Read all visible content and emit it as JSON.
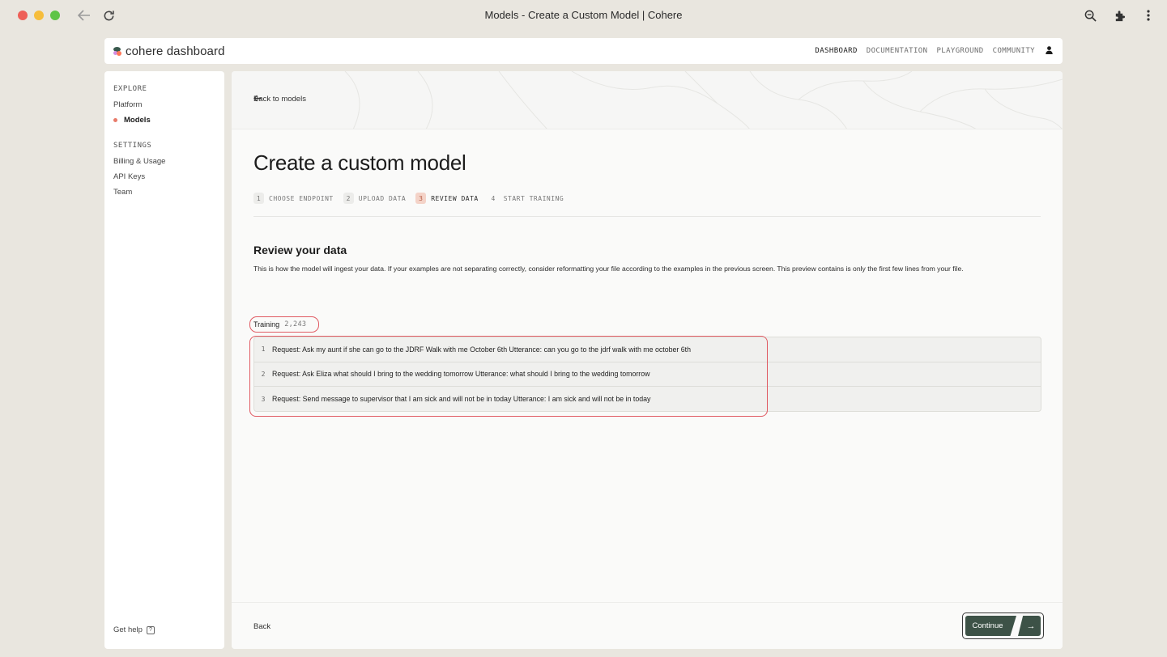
{
  "browser": {
    "title": "Models - Create a Custom Model | Cohere",
    "back_icon": "arrow-left-icon",
    "reload_icon": "reload-icon",
    "right_icons": [
      "zoom-icon",
      "extensions-icon",
      "more-vert-icon"
    ]
  },
  "topbar": {
    "logo_text": "cohere dashboard",
    "nav": [
      "DASHBOARD",
      "DOCUMENTATION",
      "PLAYGROUND",
      "COMMUNITY"
    ],
    "active_nav": "DASHBOARD",
    "user_icon": "user-icon",
    "accent": "#e87b6a"
  },
  "sidebar": {
    "explore_label": "EXPLORE",
    "explore_items": [
      "Platform",
      "Models"
    ],
    "active_item": "Models",
    "settings_label": "SETTINGS",
    "settings_items": [
      "Billing & Usage",
      "API Keys",
      "Team"
    ],
    "help_label": "Get help",
    "help_icon": "?"
  },
  "main": {
    "back_link": "Back to models",
    "title": "Create a custom model",
    "steps": [
      {
        "num": "1",
        "label": "CHOOSE ENDPOINT"
      },
      {
        "num": "2",
        "label": "UPLOAD DATA"
      },
      {
        "num": "3",
        "label": "REVIEW DATA"
      },
      {
        "num": "4",
        "label": "START TRAINING"
      }
    ],
    "active_step": "3",
    "section_title": "Review your data",
    "section_desc": "This is how the model will ingest your data. If your examples are not separating correctly, consider reformatting your file according to the examples in the previous screen. This preview contains is only the first few lines from your file.",
    "tab": {
      "label": "Training",
      "count": "2,243"
    },
    "rows": [
      {
        "num": "1",
        "text": "Request: Ask my aunt if she can go to the JDRF Walk with me October 6th Utterance: can you go to the jdrf walk with me october 6th"
      },
      {
        "num": "2",
        "text": "Request: Ask Eliza what should I bring to the wedding tomorrow Utterance: what should I bring to the wedding tomorrow"
      },
      {
        "num": "3",
        "text": "Request: Send message to supervisor that I am sick and will not be in today Utterance: I am sick and will not be in today"
      }
    ]
  },
  "footer": {
    "back_label": "Back",
    "continue_label": "Continue",
    "continue_icon": "→",
    "button_color": "#3d5247"
  }
}
